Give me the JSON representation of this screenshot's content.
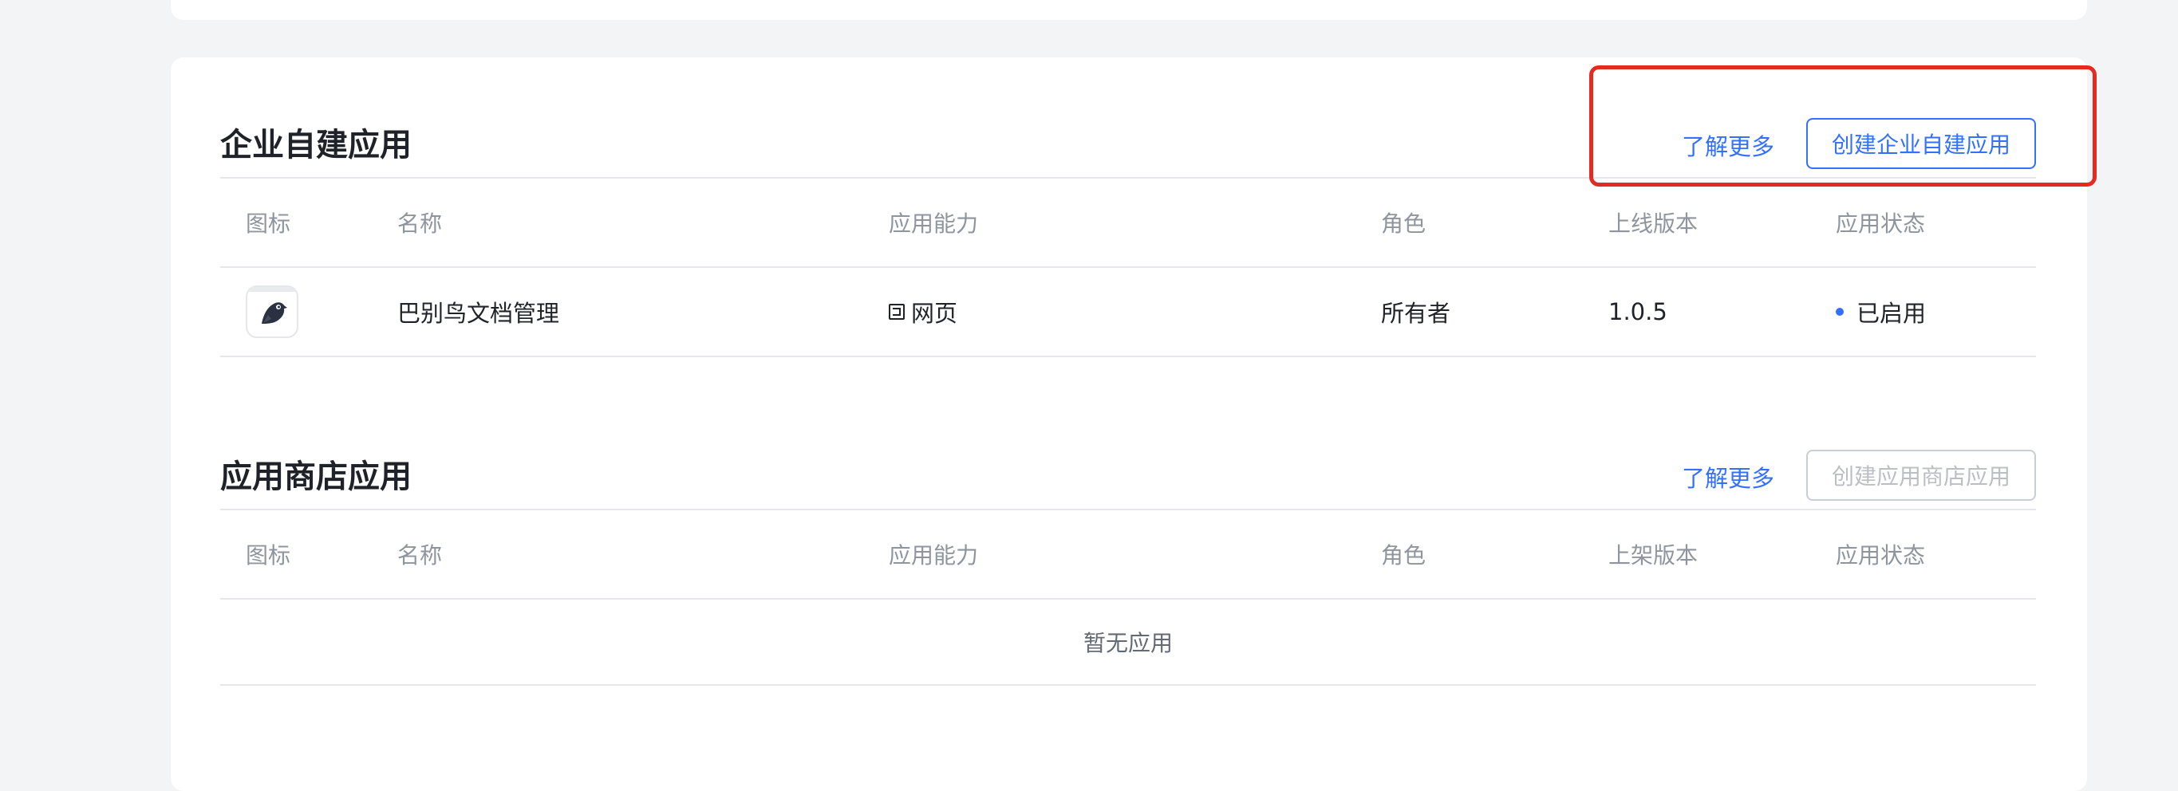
{
  "custom_apps": {
    "title": "企业自建应用",
    "learn_more": "了解更多",
    "create_button": "创建企业自建应用",
    "columns": {
      "icon": "图标",
      "name": "名称",
      "ability": "应用能力",
      "role": "角色",
      "version": "上线版本",
      "status": "应用状态"
    },
    "rows": [
      {
        "icon": "bird-app-icon",
        "name": "巴别鸟文档管理",
        "ability": "网页",
        "role": "所有者",
        "version": "1.0.5",
        "status": "已启用"
      }
    ]
  },
  "store_apps": {
    "title": "应用商店应用",
    "learn_more": "了解更多",
    "create_button": "创建应用商店应用",
    "columns": {
      "icon": "图标",
      "name": "名称",
      "ability": "应用能力",
      "role": "角色",
      "version": "上架版本",
      "status": "应用状态"
    },
    "empty_text": "暂无应用"
  },
  "colors": {
    "accent": "#3370ff",
    "highlight": "#e32b22",
    "page_bg": "#f3f4f6"
  }
}
